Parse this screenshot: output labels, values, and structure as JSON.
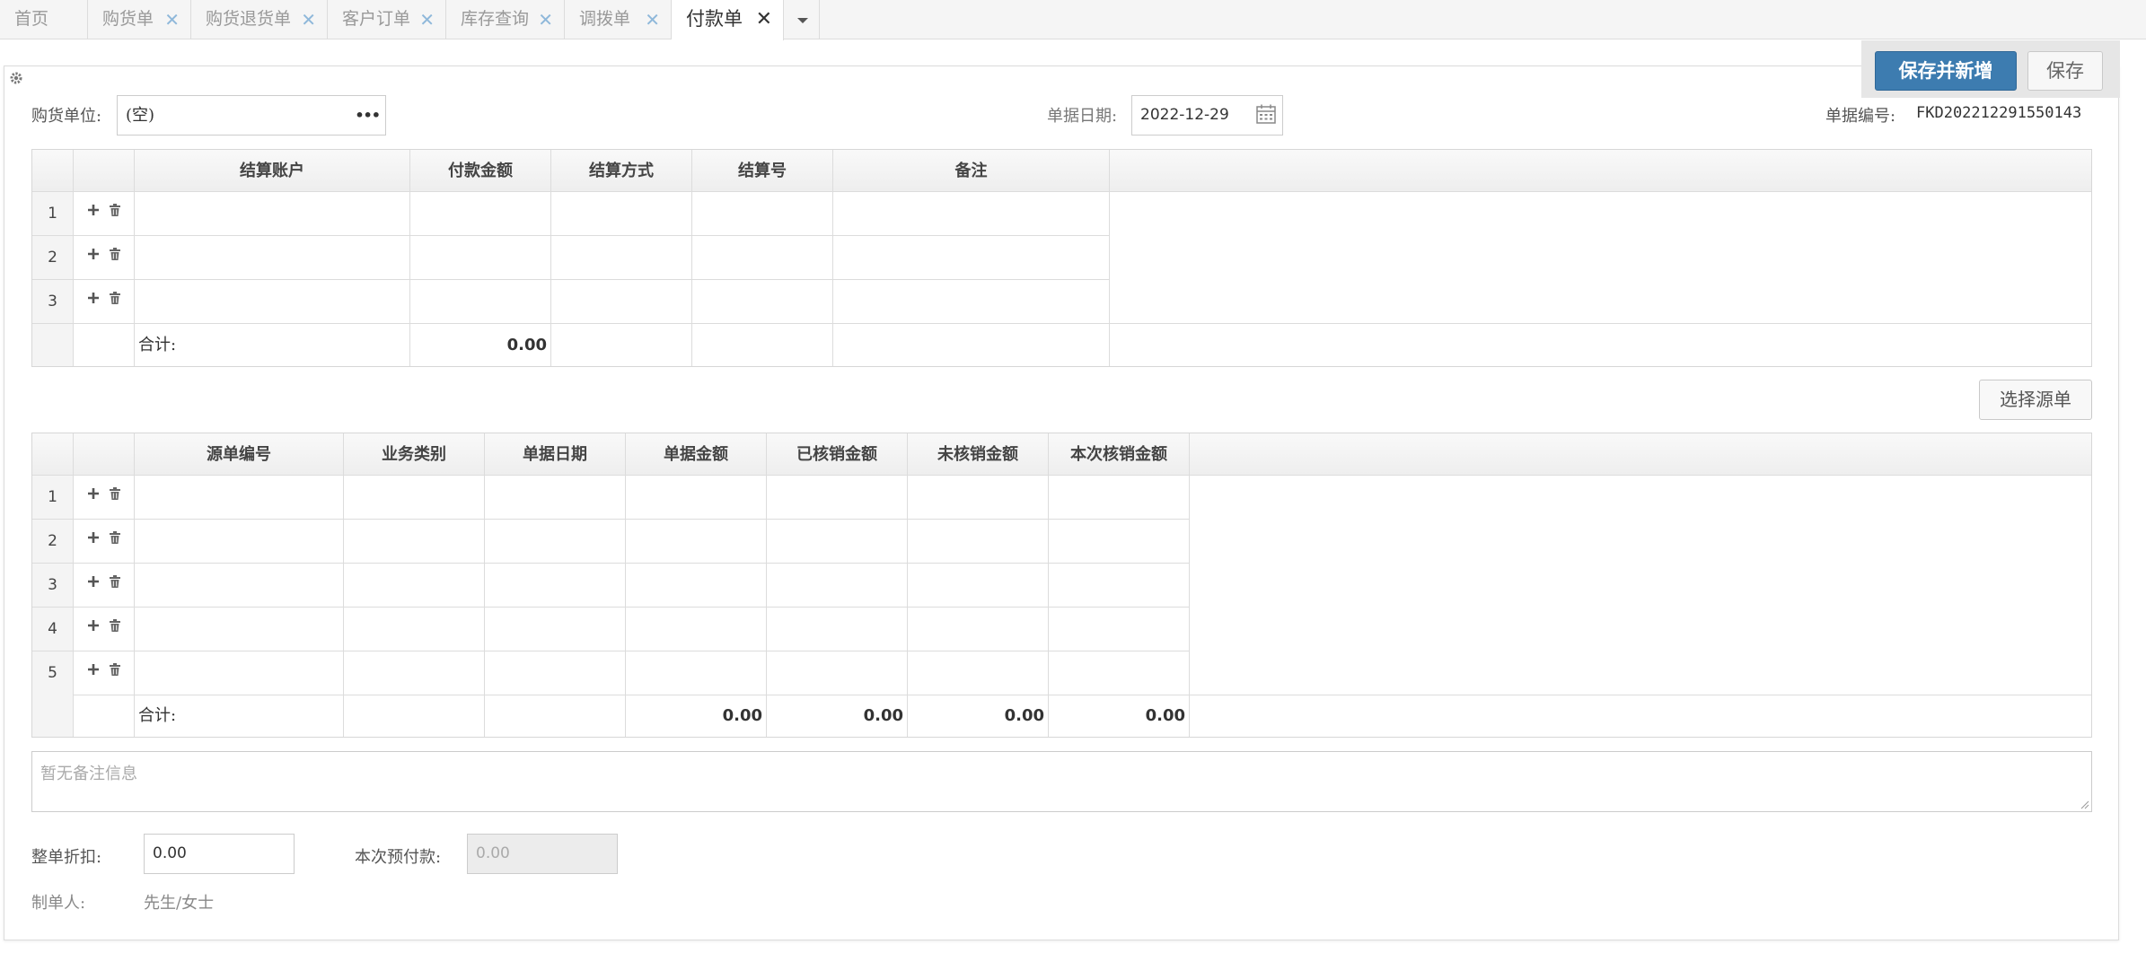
{
  "tabs": [
    {
      "label": "首页",
      "closable": false,
      "active": false
    },
    {
      "label": "购货单",
      "closable": true,
      "active": false
    },
    {
      "label": "购货退货单",
      "closable": true,
      "active": false
    },
    {
      "label": "客户订单",
      "closable": true,
      "active": false
    },
    {
      "label": "库存查询",
      "closable": true,
      "active": false
    },
    {
      "label": "调拨单",
      "closable": true,
      "active": false
    },
    {
      "label": "付款单",
      "closable": true,
      "active": true
    }
  ],
  "toolbar": {
    "save_new_label": "保存并新增",
    "save_label": "保存"
  },
  "header": {
    "supplier_label": "购货单位:",
    "supplier_value": "(空)",
    "date_label": "单据日期:",
    "date_value": "2022-12-29",
    "billno_label": "单据编号:",
    "billno_value": "FKD202212291550143"
  },
  "settlement_grid": {
    "columns": [
      "结算账户",
      "付款金额",
      "结算方式",
      "结算号",
      "备注"
    ],
    "row_numbers": [
      "1",
      "2",
      "3"
    ],
    "total_label": "合计:",
    "total_amount": "0.00"
  },
  "select_source_label": "选择源单",
  "source_grid": {
    "columns": [
      "源单编号",
      "业务类别",
      "单据日期",
      "单据金额",
      "已核销金额",
      "未核销金额",
      "本次核销金额"
    ],
    "row_numbers": [
      "1",
      "2",
      "3",
      "4",
      "5"
    ],
    "total_label": "合计:",
    "totals": [
      "0.00",
      "0.00",
      "0.00",
      "0.00"
    ]
  },
  "remark_placeholder": "暂无备注信息",
  "footer": {
    "discount_label": "整单折扣:",
    "discount_value": "0.00",
    "prepay_label": "本次预付款:",
    "prepay_value": "0.00",
    "creator_label": "制单人:",
    "creator_value": "先生/女士"
  },
  "colors": {
    "primary": "#3d7cb0",
    "tab_close": "#8fb8da",
    "border": "#dcdcdc"
  },
  "icons": [
    "settings-icon",
    "ellipsis-icon",
    "calendar-icon",
    "plus-icon",
    "trash-icon",
    "close-icon",
    "chevron-down-icon"
  ]
}
